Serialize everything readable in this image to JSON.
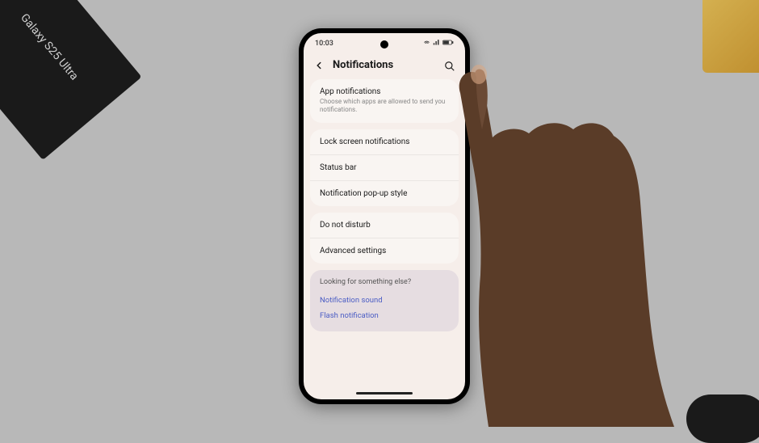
{
  "product_box": {
    "label": "Galaxy S25 Ultra"
  },
  "status_bar": {
    "time": "10:03"
  },
  "header": {
    "title": "Notifications"
  },
  "group1": {
    "item0": {
      "title": "App notifications",
      "sub": "Choose which apps are allowed to send you notifications."
    }
  },
  "group2": {
    "item0": {
      "title": "Lock screen notifications"
    },
    "item1": {
      "title": "Status bar"
    },
    "item2": {
      "title": "Notification pop-up style"
    }
  },
  "group3": {
    "item0": {
      "title": "Do not disturb"
    },
    "item1": {
      "title": "Advanced settings"
    }
  },
  "suggest": {
    "title": "Looking for something else?",
    "link0": "Notification sound",
    "link1": "Flash notification"
  }
}
